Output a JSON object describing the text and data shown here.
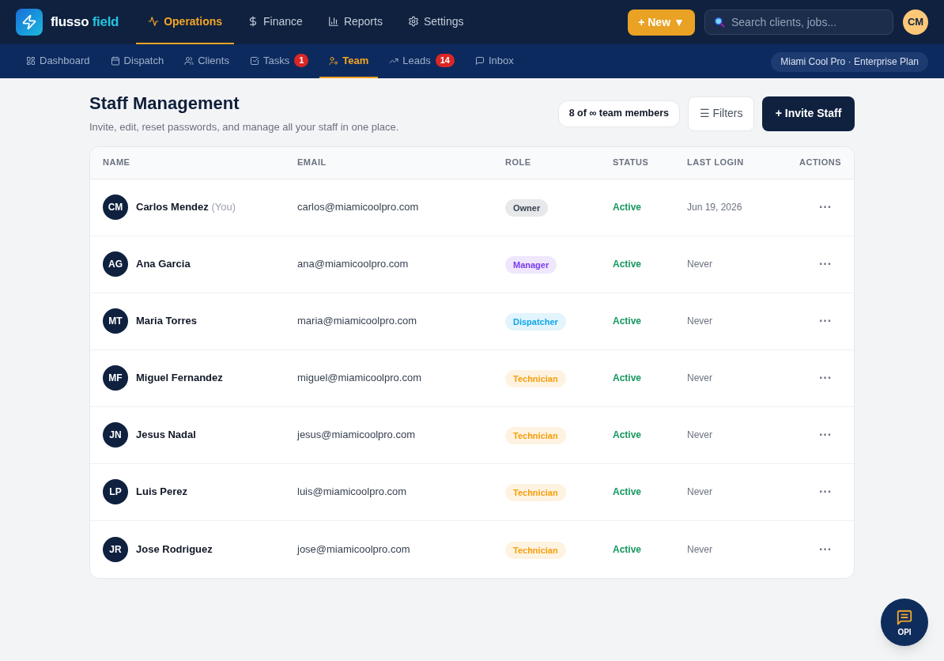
{
  "brand": {
    "name": "flusso",
    "suffix": "field"
  },
  "main_nav": [
    {
      "label": "Operations",
      "selected": true
    },
    {
      "label": "Finance",
      "selected": false
    },
    {
      "label": "Reports",
      "selected": false
    },
    {
      "label": "Settings",
      "selected": false
    }
  ],
  "new_button": "+ New ▼",
  "search": {
    "placeholder": "Search clients, jobs..."
  },
  "user_avatar": "CM",
  "sub_nav": [
    {
      "label": "Dashboard",
      "selected": false
    },
    {
      "label": "Dispatch",
      "selected": false
    },
    {
      "label": "Clients",
      "selected": false
    },
    {
      "label": "Tasks",
      "selected": false,
      "badge": "1"
    },
    {
      "label": "Team",
      "selected": true
    },
    {
      "label": "Leads",
      "selected": false,
      "badge": "14"
    },
    {
      "label": "Inbox",
      "selected": false
    }
  ],
  "plan_badge": "Miami Cool Pro · Enterprise Plan",
  "page": {
    "title": "Staff Management",
    "subtitle": "Invite, edit, reset passwords, and manage all your staff in one place.",
    "member_count": "8 of ∞ team members",
    "filters_button": "☰ Filters",
    "invite_button": "+ Invite Staff"
  },
  "table": {
    "columns": [
      "NAME",
      "EMAIL",
      "ROLE",
      "STATUS",
      "LAST LOGIN",
      "ACTIONS"
    ],
    "rows": [
      {
        "initials": "CM",
        "name": "Carlos Mendez",
        "name_note": "(You)",
        "email": "carlos@miamicoolpro.com",
        "role": {
          "label": "Owner",
          "color": "#374151"
        },
        "status": "Active",
        "last_login": "Jun 19, 2026",
        "actions": "···"
      },
      {
        "initials": "AG",
        "name": "Ana Garcia",
        "email": "ana@miamicoolpro.com",
        "role": {
          "label": "Manager",
          "color": "#7c3aed"
        },
        "status": "Active",
        "last_login": "Never",
        "actions": "···"
      },
      {
        "initials": "MT",
        "name": "Maria Torres",
        "email": "maria@miamicoolpro.com",
        "role": {
          "label": "Dispatcher",
          "color": "#0ea5e9"
        },
        "status": "Active",
        "last_login": "Never",
        "actions": "···"
      },
      {
        "initials": "MF",
        "name": "Miguel Fernandez",
        "email": "miguel@miamicoolpro.com",
        "role": {
          "label": "Technician",
          "color": "#f59e0b"
        },
        "status": "Active",
        "last_login": "Never",
        "actions": "···"
      },
      {
        "initials": "JN",
        "name": "Jesus Nadal",
        "email": "jesus@miamicoolpro.com",
        "role": {
          "label": "Technician",
          "color": "#f59e0b"
        },
        "status": "Active",
        "last_login": "Never",
        "actions": "···"
      },
      {
        "initials": "LP",
        "name": "Luis Perez",
        "email": "luis@miamicoolpro.com",
        "role": {
          "label": "Technician",
          "color": "#f59e0b"
        },
        "status": "Active",
        "last_login": "Never",
        "actions": "···"
      },
      {
        "initials": "JR",
        "name": "Jose Rodriguez",
        "email": "jose@miamicoolpro.com",
        "role": {
          "label": "Technician",
          "color": "#f59e0b"
        },
        "status": "Active",
        "last_login": "Never",
        "actions": "···"
      }
    ]
  },
  "chat_button": {
    "label": "OPI"
  }
}
